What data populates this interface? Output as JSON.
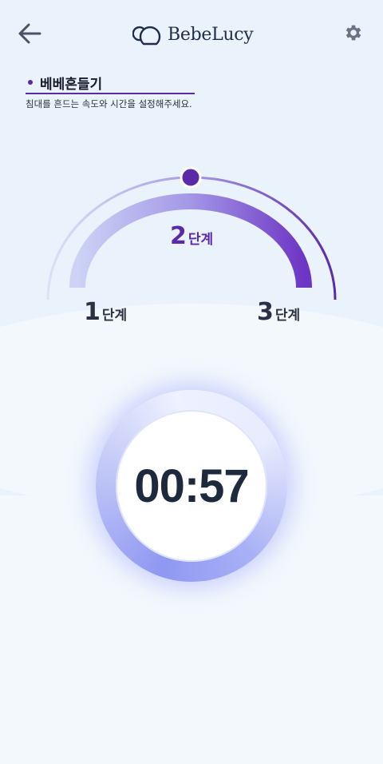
{
  "header": {
    "app_name": "BebeLucy",
    "back_icon": "arrow-left-icon",
    "settings_icon": "gear-icon"
  },
  "section": {
    "title": "베베흔들기",
    "description": "침대를 흔드는 속도와 시간을 설정해주세요."
  },
  "speed": {
    "levels": [
      {
        "num": "1",
        "unit": "단계"
      },
      {
        "num": "2",
        "unit": "단계"
      },
      {
        "num": "3",
        "unit": "단계"
      }
    ],
    "selected_level": 2
  },
  "timer": {
    "value": "00:57"
  },
  "colors": {
    "accent": "#5b2aa8",
    "accent_light": "#9a90e8",
    "text_dark": "#1d2a3d",
    "background": "#f3f8fd"
  }
}
